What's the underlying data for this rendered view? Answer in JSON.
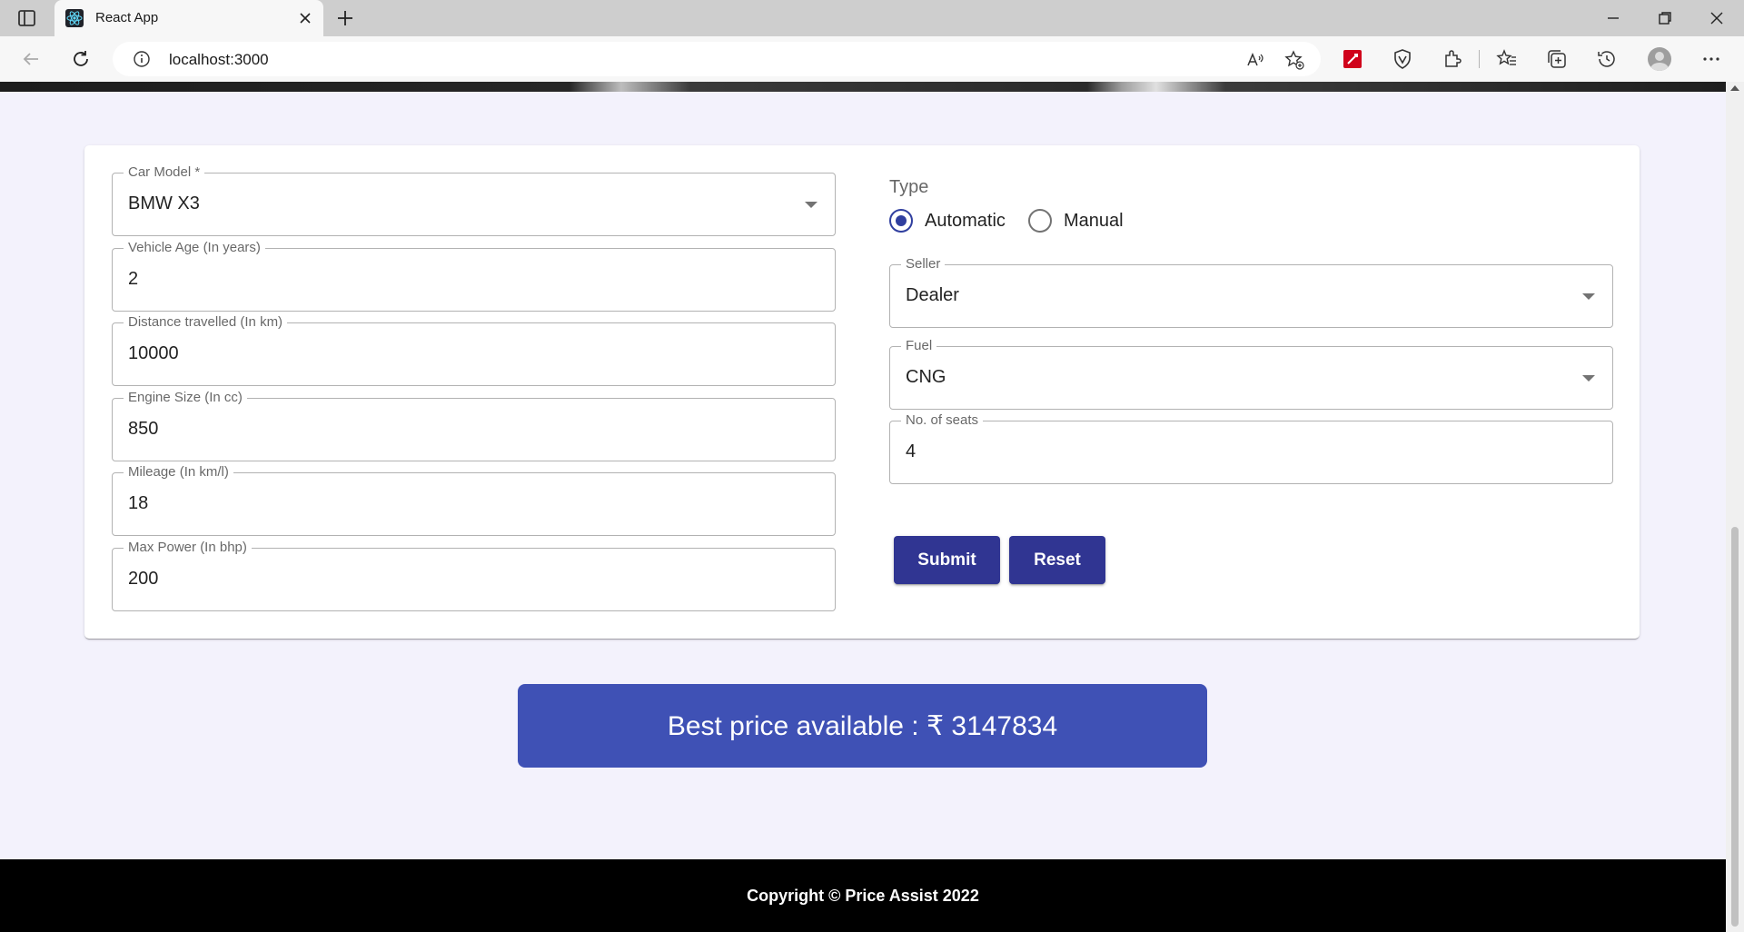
{
  "browser": {
    "tab_title": "React App",
    "url": "localhost:3000"
  },
  "form": {
    "car_model": {
      "label": "Car Model *",
      "value": "BMW X3"
    },
    "vehicle_age": {
      "label": "Vehicle Age (In years)",
      "value": "2"
    },
    "distance": {
      "label": "Distance travelled (In km)",
      "value": "10000"
    },
    "engine_size": {
      "label": "Engine Size (In cc)",
      "value": "850"
    },
    "mileage": {
      "label": "Mileage (In km/l)",
      "value": "18"
    },
    "max_power": {
      "label": "Max Power (In bhp)",
      "value": "200"
    },
    "type": {
      "label": "Type",
      "options": [
        "Automatic",
        "Manual"
      ],
      "selected": "Automatic"
    },
    "seller": {
      "label": "Seller",
      "value": "Dealer"
    },
    "fuel": {
      "label": "Fuel",
      "value": "CNG"
    },
    "seats": {
      "label": "No. of seats",
      "value": "4"
    },
    "submit_label": "Submit",
    "reset_label": "Reset"
  },
  "result": {
    "text": "Best price available : ₹ 3147834"
  },
  "footer": {
    "text": "Copyright © Price Assist 2022"
  },
  "colors": {
    "primary_button": "#303592",
    "banner": "#3f51b5",
    "radio_checked": "#303f9f",
    "page_background": "#f3f2fc",
    "footer_background": "#000000"
  },
  "icons": [
    "sidebar-toggle-icon",
    "react-logo-icon",
    "close-icon",
    "plus-icon",
    "minimize-icon",
    "restore-icon",
    "back-arrow-icon",
    "refresh-icon",
    "info-icon",
    "read-aloud-icon",
    "add-favorite-icon",
    "pdf-extension-icon",
    "shield-extension-icon",
    "extensions-icon",
    "favorites-icon",
    "collections-icon",
    "history-icon",
    "profile-icon",
    "more-icon",
    "chevron-down-icon"
  ]
}
